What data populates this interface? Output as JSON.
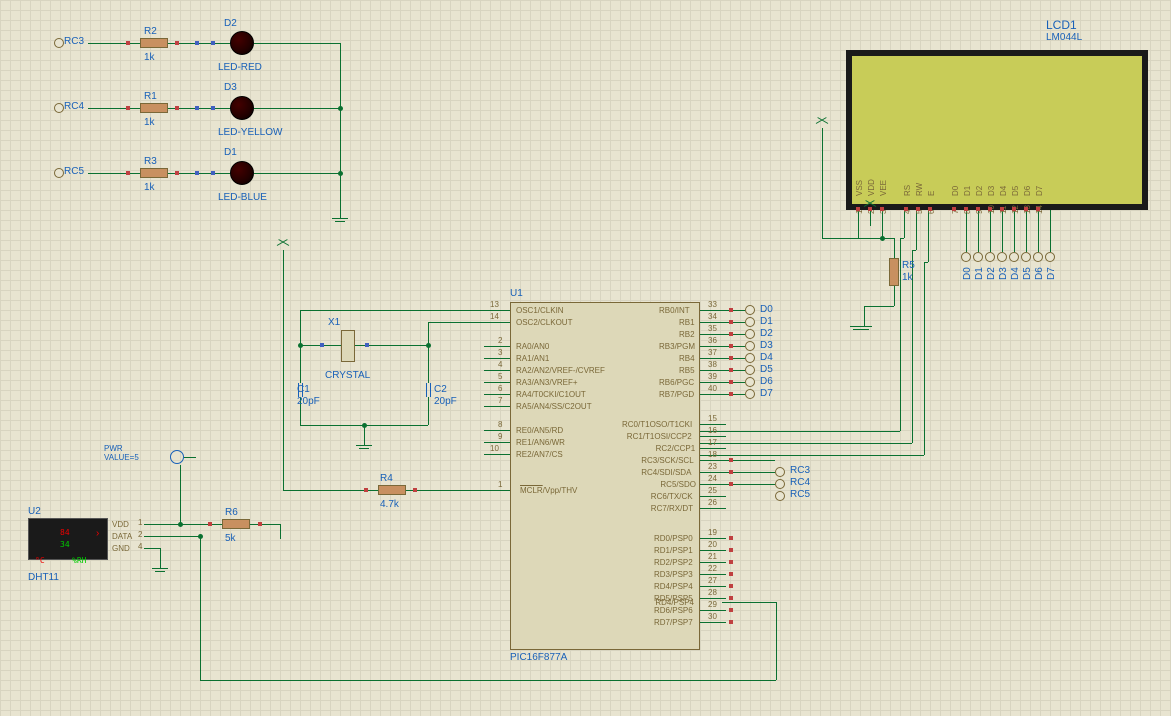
{
  "components": {
    "u1": {
      "ref": "U1",
      "value": "PIC16F877A"
    },
    "u2": {
      "ref": "U2",
      "value": "DHT11",
      "temp": "84",
      "hum": "34",
      "units_t": "°C",
      "units_h": "%RH"
    },
    "lcd1": {
      "ref": "LCD1",
      "value": "LM044L"
    },
    "x1": {
      "ref": "X1",
      "value": "CRYSTAL"
    },
    "c1": {
      "ref": "C1",
      "value": "20pF"
    },
    "c2": {
      "ref": "C2",
      "value": "20pF"
    },
    "r1": {
      "ref": "R1",
      "value": "1k"
    },
    "r2": {
      "ref": "R2",
      "value": "1k"
    },
    "r3": {
      "ref": "R3",
      "value": "1k"
    },
    "r4": {
      "ref": "R4",
      "value": "4.7k"
    },
    "r5": {
      "ref": "R5",
      "value": "1k"
    },
    "r6": {
      "ref": "R6",
      "value": "5k"
    },
    "d1": {
      "ref": "D1",
      "value": "LED-BLUE"
    },
    "d2": {
      "ref": "D2",
      "value": "LED-RED"
    },
    "d3": {
      "ref": "D3",
      "value": "LED-YELLOW"
    },
    "pwr": {
      "label": "PWR",
      "value": "VALUE=5"
    }
  },
  "terminals": [
    "RC3",
    "RC4",
    "RC5",
    "D0",
    "D1",
    "D2",
    "D3",
    "D4",
    "D5",
    "D6",
    "D7",
    "RC3_r",
    "RC4_r",
    "RC5_r"
  ],
  "u1_left": [
    {
      "n": "13",
      "t": "OSC1/CLKIN"
    },
    {
      "n": "14",
      "t": "OSC2/CLKOUT"
    },
    {
      "n": "2",
      "t": "RA0/AN0"
    },
    {
      "n": "3",
      "t": "RA1/AN1"
    },
    {
      "n": "4",
      "t": "RA2/AN2/VREF-/CVREF"
    },
    {
      "n": "5",
      "t": "RA3/AN3/VREF+"
    },
    {
      "n": "6",
      "t": "RA4/T0CKI/C1OUT"
    },
    {
      "n": "7",
      "t": "RA5/AN4/SS/C2OUT"
    },
    {
      "n": "8",
      "t": "RE0/AN5/RD",
      "ov": "RD"
    },
    {
      "n": "9",
      "t": "RE1/AN6/WR",
      "ov": "WR"
    },
    {
      "n": "10",
      "t": "RE2/AN7/CS",
      "ov": "CS"
    },
    {
      "n": "1",
      "t": "MCLR/Vpp/THV",
      "ov": "MCLR"
    }
  ],
  "u1_right_top": [
    {
      "n": "33",
      "t": "RB0/INT"
    },
    {
      "n": "34",
      "t": "RB1"
    },
    {
      "n": "35",
      "t": "RB2"
    },
    {
      "n": "36",
      "t": "RB3/PGM"
    },
    {
      "n": "37",
      "t": "RB4"
    },
    {
      "n": "38",
      "t": "RB5"
    },
    {
      "n": "39",
      "t": "RB6/PGC"
    },
    {
      "n": "40",
      "t": "RB7/PGD"
    }
  ],
  "u1_right_mid": [
    {
      "n": "15",
      "t": "RC0/T1OSO/T1CKI"
    },
    {
      "n": "16",
      "t": "RC1/T1OSI/CCP2"
    },
    {
      "n": "17",
      "t": "RC2/CCP1"
    },
    {
      "n": "18",
      "t": "RC3/SCK/SCL"
    },
    {
      "n": "23",
      "t": "RC4/SDI/SDA"
    },
    {
      "n": "24",
      "t": "RC5/SDO"
    },
    {
      "n": "25",
      "t": "RC6/TX/CK"
    },
    {
      "n": "26",
      "t": "RC7/RX/DT"
    }
  ],
  "u1_right_bot": [
    {
      "n": "19",
      "t": "RD0/PSP0"
    },
    {
      "n": "20",
      "t": "RD1/PSP1"
    },
    {
      "n": "21",
      "t": "RD2/PSP2"
    },
    {
      "n": "22",
      "t": "RD3/PSP3"
    },
    {
      "n": "27",
      "t": "RD4/PSP4"
    },
    {
      "n": "28",
      "t": "RD5/PSP5"
    },
    {
      "n": "29",
      "t": "RD6/PSP6"
    },
    {
      "n": "30",
      "t": "RD7/PSP7"
    }
  ],
  "lcd_pins": [
    {
      "n": "1",
      "t": "VSS"
    },
    {
      "n": "2",
      "t": "VDD"
    },
    {
      "n": "3",
      "t": "VEE"
    },
    {
      "n": "4",
      "t": "RS"
    },
    {
      "n": "5",
      "t": "RW"
    },
    {
      "n": "6",
      "t": "E"
    },
    {
      "n": "7",
      "t": "D0"
    },
    {
      "n": "8",
      "t": "D1"
    },
    {
      "n": "9",
      "t": "D2"
    },
    {
      "n": "10",
      "t": "D3"
    },
    {
      "n": "11",
      "t": "D4"
    },
    {
      "n": "12",
      "t": "D5"
    },
    {
      "n": "13",
      "t": "D6"
    },
    {
      "n": "14",
      "t": "D7"
    }
  ],
  "dht_pins": [
    {
      "n": "1",
      "t": "VDD"
    },
    {
      "n": "2",
      "t": "DATA"
    },
    {
      "n": "4",
      "t": "GND"
    }
  ],
  "lcd_data_terms": [
    "D0",
    "D1",
    "D2",
    "D3",
    "D4",
    "D5",
    "D6",
    "D7"
  ]
}
